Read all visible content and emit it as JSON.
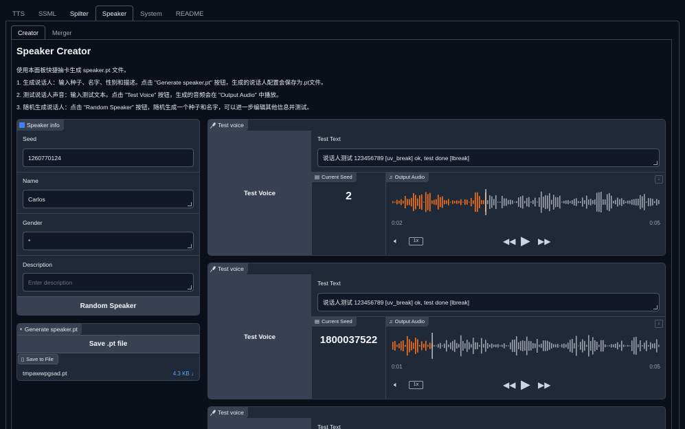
{
  "top_tabs": [
    "TTS",
    "SSML",
    "Spilter",
    "Speaker",
    "System",
    "README"
  ],
  "sub_tabs": [
    "Creator",
    "Merger"
  ],
  "page_title": "Speaker Creator",
  "description": [
    "使用本面板快捷抽卡生成 speaker.pt 文件。",
    "1. 生成说话人：输入种子、名字、性别和描述。点击 \"Generate speaker.pt\" 按钮，生成的说话人配置会保存为.pt文件。",
    "2. 测试说话人声音：输入测试文本。点击 \"Test Voice\" 按钮，生成的音频会在 \"Output Audio\" 中播放。",
    "3. 随机生成说话人：点击 \"Random Speaker\" 按钮，随机生成一个种子和名字，可以进一步编辑其他信息并测试。"
  ],
  "speaker_info": {
    "label": "Speaker info",
    "seed_label": "Seed",
    "seed_value": "1260770124",
    "name_label": "Name",
    "name_value": "Carlos",
    "gender_label": "Gender",
    "gender_value": "*",
    "description_label": "Description",
    "description_placeholder": "Enter description",
    "random_button": "Random Speaker"
  },
  "generate": {
    "label": "Generate speaker.pt",
    "save_button": "Save .pt file",
    "save_to_file_label": "Save to File",
    "file_name": "tmpawwpgsad.pt",
    "file_size": "4.3 KB ↓"
  },
  "test_voices": [
    {
      "label": "Test voice",
      "button": "Test Voice",
      "text_label": "Test Text",
      "text_value": "说话人测试 123456789 [uv_break] ok, test done [lbreak]",
      "seed_label": "Current Seed",
      "seed_value": "2",
      "audio_label": "Output Audio",
      "time_current": "0:02",
      "time_total": "0:05",
      "speed": "1x",
      "progress": 0.35
    },
    {
      "label": "Test voice",
      "button": "Test Voice",
      "text_label": "Test Text",
      "text_value": "说话人测试 123456789 [uv_break] ok, test done [lbreak]",
      "seed_label": "Current Seed",
      "seed_value": "1800037522",
      "audio_label": "Output Audio",
      "time_current": "0:01",
      "time_total": "0:05",
      "speed": "1x",
      "progress": 0.15
    },
    {
      "label": "Test voice",
      "text_label": "Test Text"
    }
  ],
  "colors": {
    "background": "#0b0f19",
    "panel": "#1f2937",
    "border": "#374151",
    "accent_wave": "#f97316",
    "link": "#60a5fa"
  }
}
